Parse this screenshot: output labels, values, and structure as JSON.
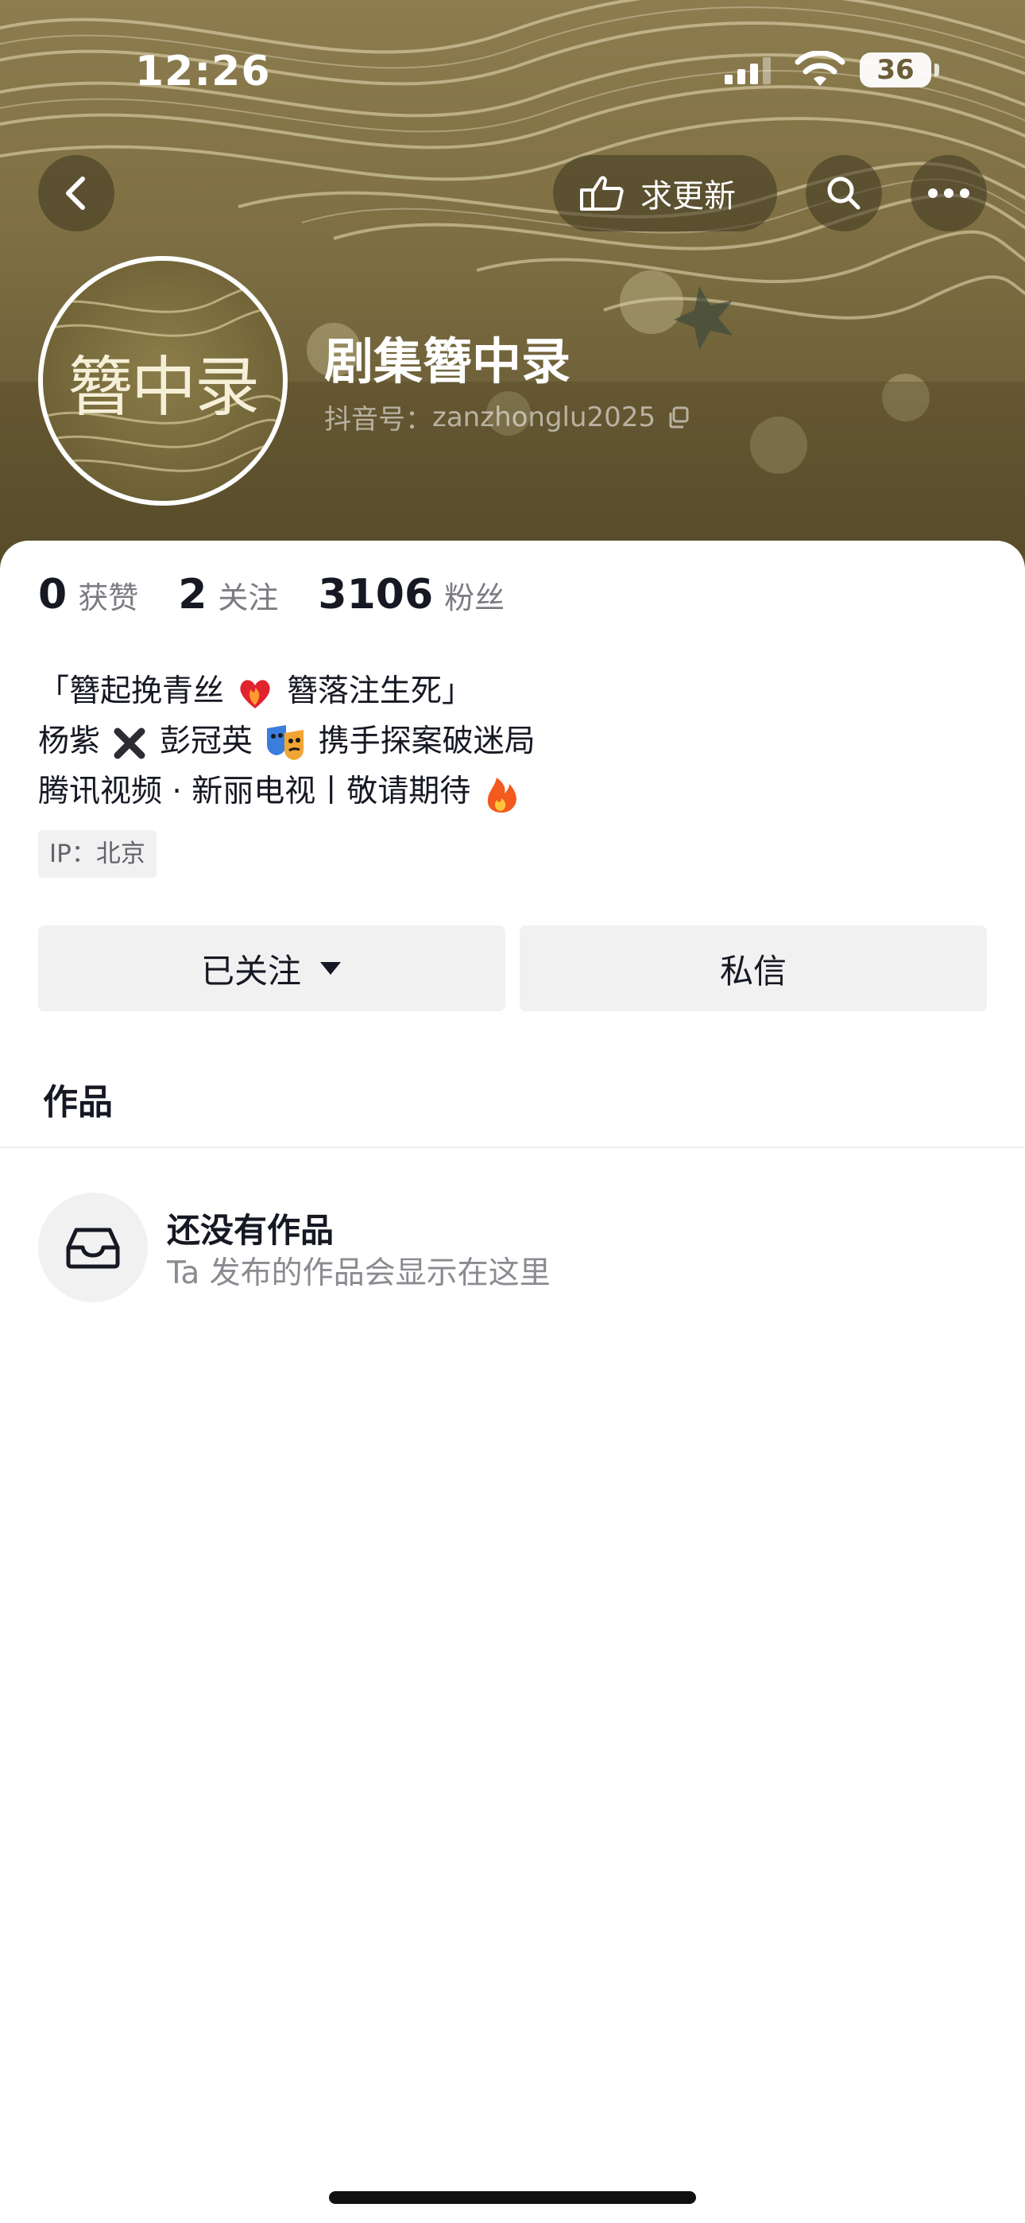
{
  "status_bar": {
    "time": "12:26",
    "battery": "36"
  },
  "header": {
    "update_label": "求更新"
  },
  "profile": {
    "avatar_text": "簪中录",
    "name": "剧集簪中录",
    "id_label": "抖音号：",
    "id_value": "zanzhonglu2025"
  },
  "stats": [
    {
      "num": "0",
      "label": "获赞"
    },
    {
      "num": "2",
      "label": "关注"
    },
    {
      "num": "3106",
      "label": "粉丝"
    }
  ],
  "bio": {
    "line1_a": "「簪起挽青丝",
    "line1_b": "簪落注生死」",
    "line2_a": "杨紫",
    "line2_b": "彭冠英",
    "line2_c": "携手探案破迷局",
    "line3": "腾讯视频 · 新丽电视丨敬请期待"
  },
  "ip_tag": "IP：北京",
  "actions": {
    "follow_label": "已关注",
    "dm_label": "私信"
  },
  "tabs": {
    "works": "作品"
  },
  "empty_state": {
    "title": "还没有作品",
    "subtitle": "Ta 发布的作品会显示在这里"
  },
  "colors": {
    "banner": "#7f7044",
    "text_primary": "#161823",
    "text_secondary": "#7b7c82",
    "button_bg": "#f1f1f2"
  },
  "icons": [
    "back-icon",
    "hand-icon",
    "search-icon",
    "more-icon",
    "copy-icon",
    "caret-down-icon",
    "inbox-icon"
  ]
}
